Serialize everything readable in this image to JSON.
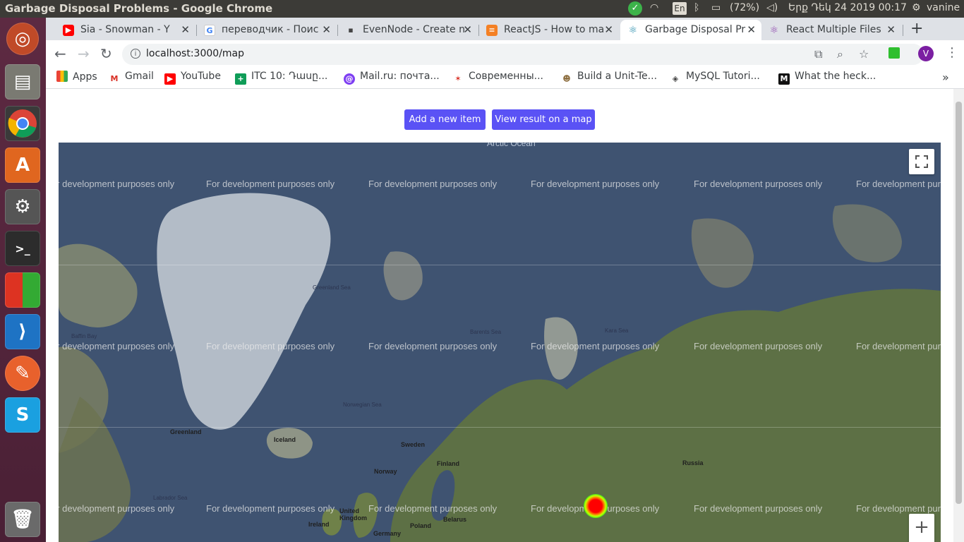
{
  "os": {
    "window_title": "Garbage Disposal Problems - Google Chrome",
    "keyboard_layout": "En",
    "battery": "(72%)",
    "clock": "Երք Դեկ 24 2019 00:17",
    "user": "vanine"
  },
  "tabs": [
    {
      "label": "Sia - Snowman - Y",
      "favicon": "youtube-icon",
      "color": "#ff0000"
    },
    {
      "label": "переводчик - Поис",
      "favicon": "google-icon",
      "color": "#4285f4"
    },
    {
      "label": "EvenNode - Create n",
      "favicon": "evennode-icon",
      "color": "#444444"
    },
    {
      "label": "ReactJS - How to ma",
      "favicon": "stackoverflow-icon",
      "color": "#f48024"
    },
    {
      "label": "Garbage Disposal Pr",
      "favicon": "react-icon",
      "color": "#61dafb",
      "active": true
    },
    {
      "label": "React Multiple Files",
      "favicon": "react-icon",
      "color": "#8e44ad"
    }
  ],
  "toolbar": {
    "url": "localhost:3000/map"
  },
  "bookmarks": [
    {
      "label": "Apps",
      "icon": "apps-grid-icon",
      "color": "#4285f4"
    },
    {
      "label": "Gmail",
      "icon": "gmail-icon",
      "color": "#d93025"
    },
    {
      "label": "YouTube",
      "icon": "youtube-icon",
      "color": "#ff0000"
    },
    {
      "label": "ITC 10: Դասը...",
      "icon": "itc-icon",
      "color": "#0f9d58"
    },
    {
      "label": "Mail.ru: почта...",
      "icon": "mailru-icon",
      "color": "#7e3ff2"
    },
    {
      "label": "Современны...",
      "icon": "bookmark-icon",
      "color": "#d93025"
    },
    {
      "label": "Build a Unit-Te...",
      "icon": "bookmark-icon",
      "color": "#8d6e3f"
    },
    {
      "label": "MySQL Tutori...",
      "icon": "mysql-icon",
      "color": "#444444"
    },
    {
      "label": "What the heck...",
      "icon": "medium-icon",
      "color": "#111111"
    }
  ],
  "page": {
    "add_button": "Add a new item",
    "view_button": "View result on a map"
  },
  "map": {
    "watermark": "For development purposes only",
    "top_label": "Arctic Ocean",
    "places": {
      "greenland": "Greenland",
      "iceland": "Iceland",
      "sweden": "Sweden",
      "finland": "Finland",
      "norway": "Norway",
      "russia": "Russia",
      "uk": "United Kingdom",
      "ireland": "Ireland",
      "poland": "Poland",
      "belarus": "Belarus",
      "germany": "Germany"
    },
    "seas": {
      "greenland_sea": "Greenland Sea",
      "barents_sea": "Barents Sea",
      "kara_sea": "Kara Sea",
      "baffin_bay": "Baffin Bay",
      "norwegian_sea": "Norwegian Sea",
      "labrador_sea": "Labrador Sea"
    },
    "heat_point_color": "#ff0000"
  }
}
